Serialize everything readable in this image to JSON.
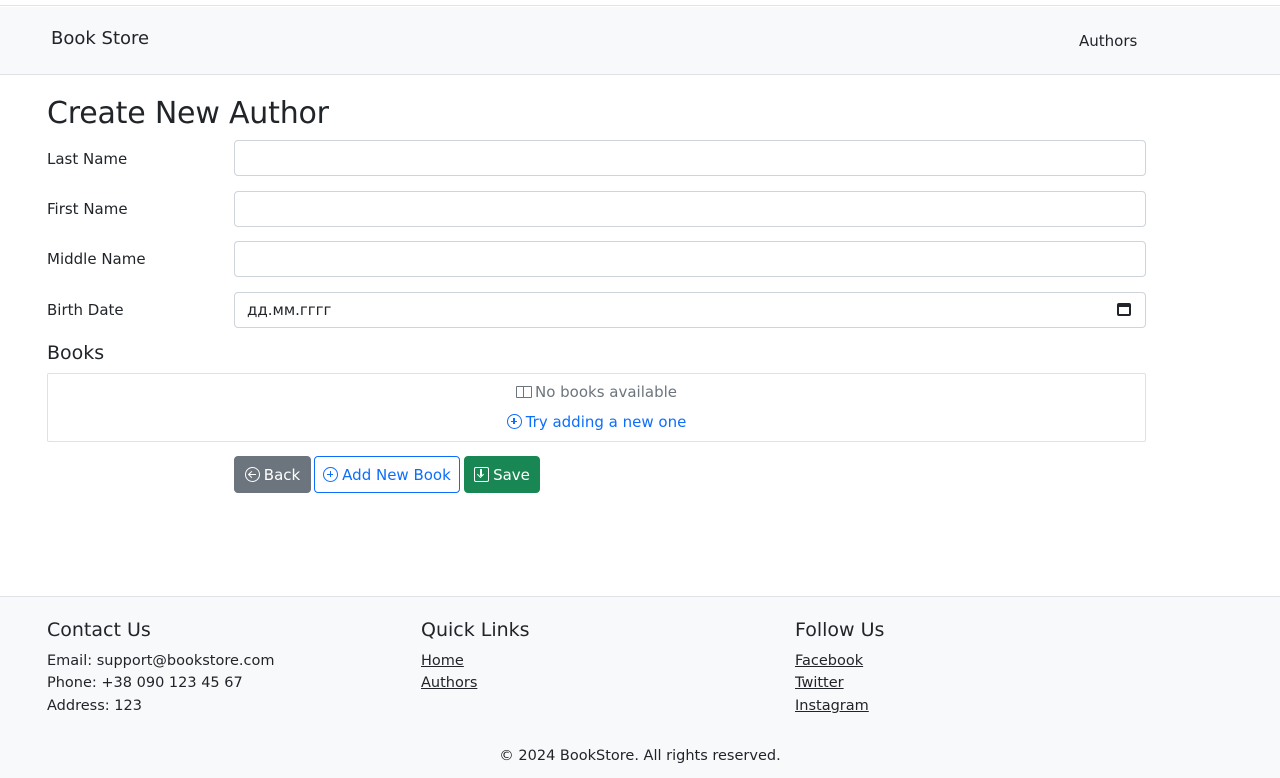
{
  "navbar": {
    "brand": "Book Store",
    "links": [
      "Authors"
    ]
  },
  "page": {
    "title": "Create New Author"
  },
  "form": {
    "fields": [
      {
        "label": "Last Name",
        "value": ""
      },
      {
        "label": "First Name",
        "value": ""
      },
      {
        "label": "Middle Name",
        "value": ""
      },
      {
        "label": "Birth Date",
        "value": "дд.мм.гггг"
      }
    ]
  },
  "books": {
    "title": "Books",
    "empty_text": "No books available",
    "empty_icon": "book-icon",
    "add_link": "Try adding a new one",
    "add_icon": "plus-circle-icon"
  },
  "actions": {
    "back": "Back",
    "add_new_book": "Add New Book",
    "save": "Save",
    "colors": {
      "back": "#6c757d",
      "add": "#0d6efd",
      "save": "#198754"
    }
  },
  "footer": {
    "contact": {
      "title": "Contact Us",
      "lines": [
        "Email: support@bookstore.com",
        "Phone: +38 090 123 45 67",
        "Address: 123"
      ]
    },
    "quick_links": {
      "title": "Quick Links",
      "links": [
        "Home",
        "Authors"
      ]
    },
    "follow": {
      "title": "Follow Us",
      "links": [
        "Facebook",
        "Twitter",
        "Instagram"
      ]
    },
    "copyright": "© 2024 BookStore. All rights reserved."
  }
}
